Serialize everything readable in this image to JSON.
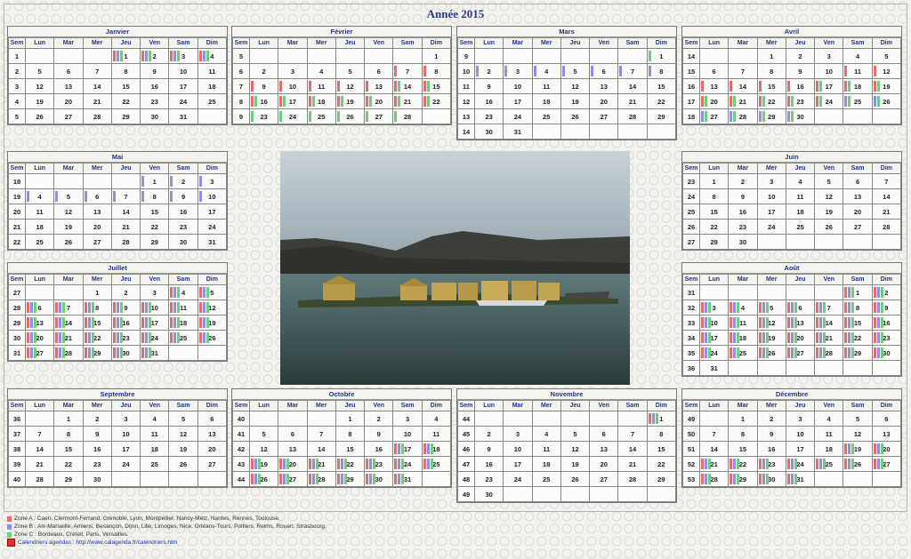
{
  "title": "Année 2015",
  "weekday_headers": [
    "Sem",
    "Lun",
    "Mar",
    "Mer",
    "Jeu",
    "Ven",
    "Sam",
    "Dim"
  ],
  "zone_colors": {
    "A": "#e86a6a",
    "B": "#8f8fe6",
    "C": "#6ad07a"
  },
  "months": [
    {
      "name": "Janvier",
      "weeks": [
        [
          1,
          "",
          "",
          "",
          1,
          2,
          3,
          4
        ],
        [
          2,
          5,
          6,
          7,
          8,
          9,
          10,
          11
        ],
        [
          3,
          12,
          13,
          14,
          15,
          16,
          17,
          18
        ],
        [
          4,
          19,
          20,
          21,
          22,
          23,
          24,
          25
        ],
        [
          5,
          26,
          27,
          28,
          29,
          30,
          31,
          ""
        ]
      ]
    },
    {
      "name": "Février",
      "weeks": [
        [
          5,
          "",
          "",
          "",
          "",
          "",
          "",
          1
        ],
        [
          6,
          2,
          3,
          4,
          5,
          6,
          7,
          8
        ],
        [
          7,
          9,
          10,
          11,
          12,
          13,
          14,
          15
        ],
        [
          8,
          16,
          17,
          18,
          19,
          20,
          21,
          22
        ],
        [
          9,
          23,
          24,
          25,
          26,
          27,
          28,
          ""
        ]
      ]
    },
    {
      "name": "Mars",
      "weeks": [
        [
          9,
          "",
          "",
          "",
          "",
          "",
          "",
          1
        ],
        [
          10,
          2,
          3,
          4,
          5,
          6,
          7,
          8
        ],
        [
          11,
          9,
          10,
          11,
          12,
          13,
          14,
          15
        ],
        [
          12,
          16,
          17,
          18,
          19,
          20,
          21,
          22
        ],
        [
          13,
          23,
          24,
          25,
          26,
          27,
          28,
          29
        ],
        [
          14,
          30,
          31,
          "",
          "",
          "",
          "",
          ""
        ]
      ]
    },
    {
      "name": "Avril",
      "weeks": [
        [
          14,
          "",
          "",
          1,
          2,
          3,
          4,
          5
        ],
        [
          15,
          6,
          7,
          8,
          9,
          10,
          11,
          12
        ],
        [
          16,
          13,
          14,
          15,
          16,
          17,
          18,
          19
        ],
        [
          17,
          20,
          21,
          22,
          23,
          24,
          25,
          26
        ],
        [
          18,
          27,
          28,
          29,
          30,
          "",
          "",
          ""
        ]
      ]
    },
    {
      "name": "Mai",
      "weeks": [
        [
          18,
          "",
          "",
          "",
          "",
          1,
          2,
          3
        ],
        [
          19,
          4,
          5,
          6,
          7,
          8,
          9,
          10
        ],
        [
          20,
          11,
          12,
          13,
          14,
          15,
          16,
          17
        ],
        [
          21,
          18,
          19,
          20,
          21,
          22,
          23,
          24
        ],
        [
          22,
          25,
          26,
          27,
          28,
          29,
          30,
          31
        ]
      ]
    },
    {
      "name": "Juin",
      "weeks": [
        [
          23,
          1,
          2,
          3,
          4,
          5,
          6,
          7
        ],
        [
          24,
          8,
          9,
          10,
          11,
          12,
          13,
          14
        ],
        [
          25,
          15,
          16,
          17,
          18,
          19,
          20,
          21
        ],
        [
          26,
          22,
          23,
          24,
          25,
          26,
          27,
          28
        ],
        [
          27,
          29,
          30,
          "",
          "",
          "",
          "",
          ""
        ]
      ]
    },
    {
      "name": "Juillet",
      "weeks": [
        [
          27,
          "",
          "",
          1,
          2,
          3,
          4,
          5
        ],
        [
          28,
          6,
          7,
          8,
          9,
          10,
          11,
          12
        ],
        [
          29,
          13,
          14,
          15,
          16,
          17,
          18,
          19
        ],
        [
          30,
          20,
          21,
          22,
          23,
          24,
          25,
          26
        ],
        [
          31,
          27,
          28,
          29,
          30,
          31,
          "",
          ""
        ]
      ]
    },
    {
      "name": "Août",
      "weeks": [
        [
          31,
          "",
          "",
          "",
          "",
          "",
          1,
          2
        ],
        [
          32,
          3,
          4,
          5,
          6,
          7,
          8,
          9
        ],
        [
          33,
          10,
          11,
          12,
          13,
          14,
          15,
          16
        ],
        [
          34,
          17,
          18,
          19,
          20,
          21,
          22,
          23
        ],
        [
          35,
          24,
          25,
          26,
          27,
          28,
          29,
          30
        ],
        [
          36,
          31,
          "",
          "",
          "",
          "",
          "",
          ""
        ]
      ]
    },
    {
      "name": "Septembre",
      "weeks": [
        [
          36,
          "",
          1,
          2,
          3,
          4,
          5,
          6
        ],
        [
          37,
          7,
          8,
          9,
          10,
          11,
          12,
          13
        ],
        [
          38,
          14,
          15,
          16,
          17,
          18,
          19,
          20
        ],
        [
          39,
          21,
          22,
          23,
          24,
          25,
          26,
          27
        ],
        [
          40,
          28,
          29,
          30,
          "",
          "",
          "",
          ""
        ]
      ]
    },
    {
      "name": "Octobre",
      "weeks": [
        [
          40,
          "",
          "",
          "",
          1,
          2,
          3,
          4
        ],
        [
          41,
          5,
          6,
          7,
          8,
          9,
          10,
          11
        ],
        [
          42,
          12,
          13,
          14,
          15,
          16,
          17,
          18
        ],
        [
          43,
          19,
          20,
          21,
          22,
          23,
          24,
          25
        ],
        [
          44,
          26,
          27,
          28,
          29,
          30,
          31,
          ""
        ]
      ]
    },
    {
      "name": "Novembre",
      "weeks": [
        [
          44,
          "",
          "",
          "",
          "",
          "",
          "",
          1
        ],
        [
          45,
          2,
          3,
          4,
          5,
          6,
          7,
          8
        ],
        [
          46,
          9,
          10,
          11,
          12,
          13,
          14,
          15
        ],
        [
          47,
          16,
          17,
          18,
          19,
          20,
          21,
          22
        ],
        [
          48,
          23,
          24,
          25,
          26,
          27,
          28,
          29
        ],
        [
          49,
          30,
          "",
          "",
          "",
          "",
          "",
          ""
        ]
      ]
    },
    {
      "name": "Décembre",
      "weeks": [
        [
          49,
          "",
          1,
          2,
          3,
          4,
          5,
          6
        ],
        [
          50,
          7,
          8,
          9,
          10,
          11,
          12,
          13
        ],
        [
          51,
          14,
          15,
          16,
          17,
          18,
          19,
          20
        ],
        [
          52,
          21,
          22,
          23,
          24,
          25,
          26,
          27
        ],
        [
          53,
          28,
          29,
          30,
          31,
          "",
          "",
          ""
        ]
      ]
    }
  ],
  "holidays": {
    "Janvier": {
      "1": "ABC",
      "2": "ABC",
      "3": "ABC",
      "4": "ABC"
    },
    "Février": {
      "7": "A",
      "8": "A",
      "9": "A",
      "10": "A",
      "11": "A",
      "12": "A",
      "13": "A",
      "14": "AC",
      "15": "AC",
      "16": "AC",
      "17": "AC",
      "18": "AC",
      "19": "AC",
      "20": "AC",
      "21": "AC",
      "22": "AC",
      "23": "C",
      "24": "C",
      "25": "C",
      "26": "C",
      "27": "C",
      "28": "C"
    },
    "Mars": {
      "1": "C",
      "2": "B",
      "3": "B",
      "4": "B",
      "5": "B",
      "6": "B",
      "7": "B",
      "8": "B"
    },
    "Avril": {
      "11": "A",
      "12": "A",
      "13": "A",
      "14": "A",
      "15": "A",
      "16": "A",
      "17": "AC",
      "18": "AC",
      "19": "AC",
      "20": "AC",
      "21": "AC",
      "22": "AC",
      "23": "AC",
      "24": "AC",
      "25": "BC",
      "26": "BC",
      "27": "BC",
      "28": "BC",
      "29": "BC",
      "30": "BC"
    },
    "Mai": {
      "1": "B",
      "2": "B",
      "3": "B",
      "4": "B",
      "5": "B",
      "6": "B",
      "7": "B",
      "8": "B",
      "9": "B",
      "10": "B"
    },
    "Juillet": {
      "4": "ABC",
      "5": "ABC",
      "6": "ABC",
      "7": "ABC",
      "8": "ABC",
      "9": "ABC",
      "10": "ABC",
      "11": "ABC",
      "12": "ABC",
      "13": "ABC",
      "14": "ABC",
      "15": "ABC",
      "16": "ABC",
      "17": "ABC",
      "18": "ABC",
      "19": "ABC",
      "20": "ABC",
      "21": "ABC",
      "22": "ABC",
      "23": "ABC",
      "24": "ABC",
      "25": "ABC",
      "26": "ABC",
      "27": "ABC",
      "28": "ABC",
      "29": "ABC",
      "30": "ABC",
      "31": "ABC"
    },
    "Août": {
      "1": "ABC",
      "2": "ABC",
      "3": "ABC",
      "4": "ABC",
      "5": "ABC",
      "6": "ABC",
      "7": "ABC",
      "8": "ABC",
      "9": "ABC",
      "10": "ABC",
      "11": "ABC",
      "12": "ABC",
      "13": "ABC",
      "14": "ABC",
      "15": "ABC",
      "16": "ABC",
      "17": "ABC",
      "18": "ABC",
      "19": "ABC",
      "20": "ABC",
      "21": "ABC",
      "22": "ABC",
      "23": "ABC",
      "24": "ABC",
      "25": "ABC",
      "26": "ABC",
      "27": "ABC",
      "28": "ABC",
      "29": "ABC",
      "30": "ABC"
    },
    "Octobre": {
      "17": "ABC",
      "18": "ABC",
      "19": "ABC",
      "20": "ABC",
      "21": "ABC",
      "22": "ABC",
      "23": "ABC",
      "24": "ABC",
      "25": "ABC",
      "26": "ABC",
      "27": "ABC",
      "28": "ABC",
      "29": "ABC",
      "30": "ABC",
      "31": "ABC"
    },
    "Novembre": {
      "1": "ABC"
    },
    "Décembre": {
      "19": "ABC",
      "20": "ABC",
      "21": "ABC",
      "22": "ABC",
      "23": "ABC",
      "24": "ABC",
      "25": "ABC",
      "26": "ABC",
      "27": "ABC",
      "28": "ABC",
      "29": "ABC",
      "30": "ABC",
      "31": "ABC"
    }
  },
  "legend": [
    {
      "zone": "A",
      "text": "Zone A : Caen, Clermont-Ferrand, Grenoble, Lyon, Montpellier, Nancy-Metz, Nantes, Rennes, Toulouse."
    },
    {
      "zone": "B",
      "text": "Zone B : Aix-Marseille, Amiens, Besançon, Dijon, Lille, Limoges, Nice, Orléans-Tours, Poitiers, Reims, Rouen, Strasbourg."
    },
    {
      "zone": "C",
      "text": "Zone C : Bordeaux, Créteil, Paris, Versailles."
    }
  ],
  "footer_link": "Calendriers agendas : http://www.calagenda.fr/calendriers.htm"
}
